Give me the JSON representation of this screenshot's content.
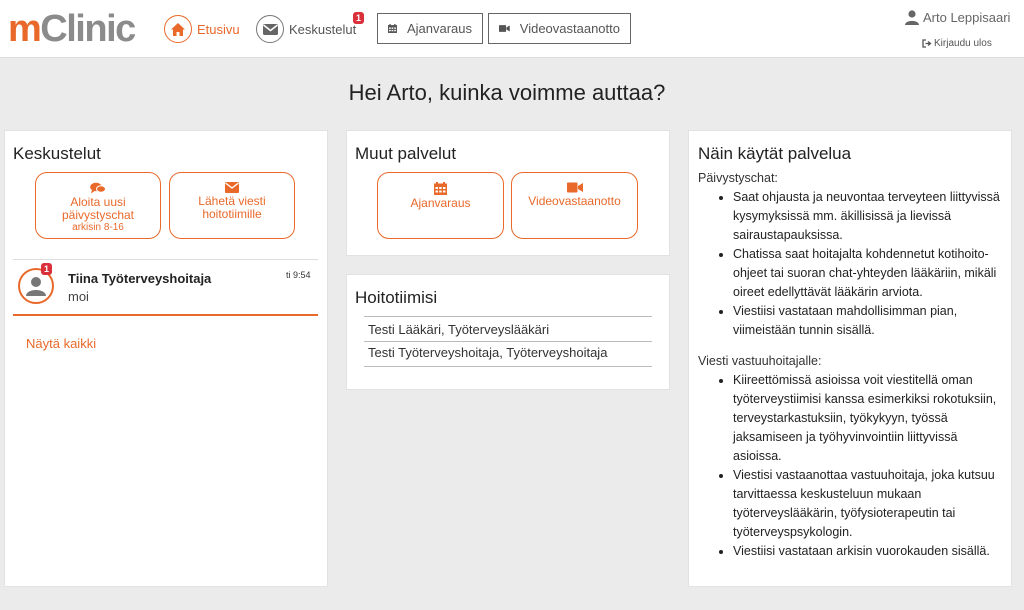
{
  "header": {
    "logo_m": "m",
    "logo_rest": "Clinic",
    "nav": {
      "home_label": "Etusivu",
      "chat_label": "Keskustelut",
      "chat_badge": "1",
      "booking_label": "Ajanvaraus",
      "video_label": "Videovastaanotto"
    },
    "user_name": "Arto Leppisaari",
    "logout_label": "Kirjaudu ulos"
  },
  "greeting": "Hei Arto, kuinka voimme auttaa?",
  "conversations": {
    "title": "Keskustelut",
    "start_chat": {
      "line1": "Aloita uusi",
      "line2": "päivystyschat",
      "line3": "arkisin 8-16"
    },
    "send_message": {
      "line1": "Lähetä viesti",
      "line2": "hoitotiimille"
    },
    "items": [
      {
        "name": "Tiina Työterveyshoitaja",
        "message": "moi",
        "time": "ti 9:54",
        "badge": "1"
      }
    ],
    "show_all": "Näytä kaikki"
  },
  "other_services": {
    "title": "Muut palvelut",
    "booking": "Ajanvaraus",
    "video": "Videovastaanotto"
  },
  "care_team": {
    "title": "Hoitotiimisi",
    "members": [
      "Testi Lääkäri, Työterveyslääkäri",
      "Testi Työterveyshoitaja, Työterveyshoitaja"
    ]
  },
  "how_to": {
    "title": "Näin käytät palvelua",
    "section1_title": "Päivystyschat:",
    "section1_items": [
      "Saat ohjausta ja neuvontaa terveyteen liittyvissä kysymyksissä mm. äkillisissä ja lievissä sairaustapauksissa.",
      "Chatissa saat hoitajalta kohdennetut kotihoito-ohjeet tai suoran chat-yhteyden lääkäriin, mikäli oireet edellyttävät lääkärin arviota.",
      "Viestiisi vastataan mahdollisimman pian, viimeistään tunnin sisällä."
    ],
    "section2_title": "Viesti vastuuhoitajalle:",
    "section2_items": [
      "Kiireettömissä asioissa voit viestitellä oman työterveystiimisi kanssa esimerkiksi rokotuksiin, terveystarkastuksiin, työkykyyn, työssä jaksamiseen ja työhyvinvointiin liittyvissä asioissa.",
      "Viestisi vastaanottaa vastuuhoitaja, joka kutsuu tarvittaessa keskusteluun mukaan työterveyslääkärin, työfysioterapeutin tai työterveyspsykologin.",
      "Viestiisi vastataan arkisin vuorokauden sisällä."
    ]
  },
  "colors": {
    "accent": "#e8692a",
    "badge": "#d9303c",
    "background": "#ebebeb"
  }
}
